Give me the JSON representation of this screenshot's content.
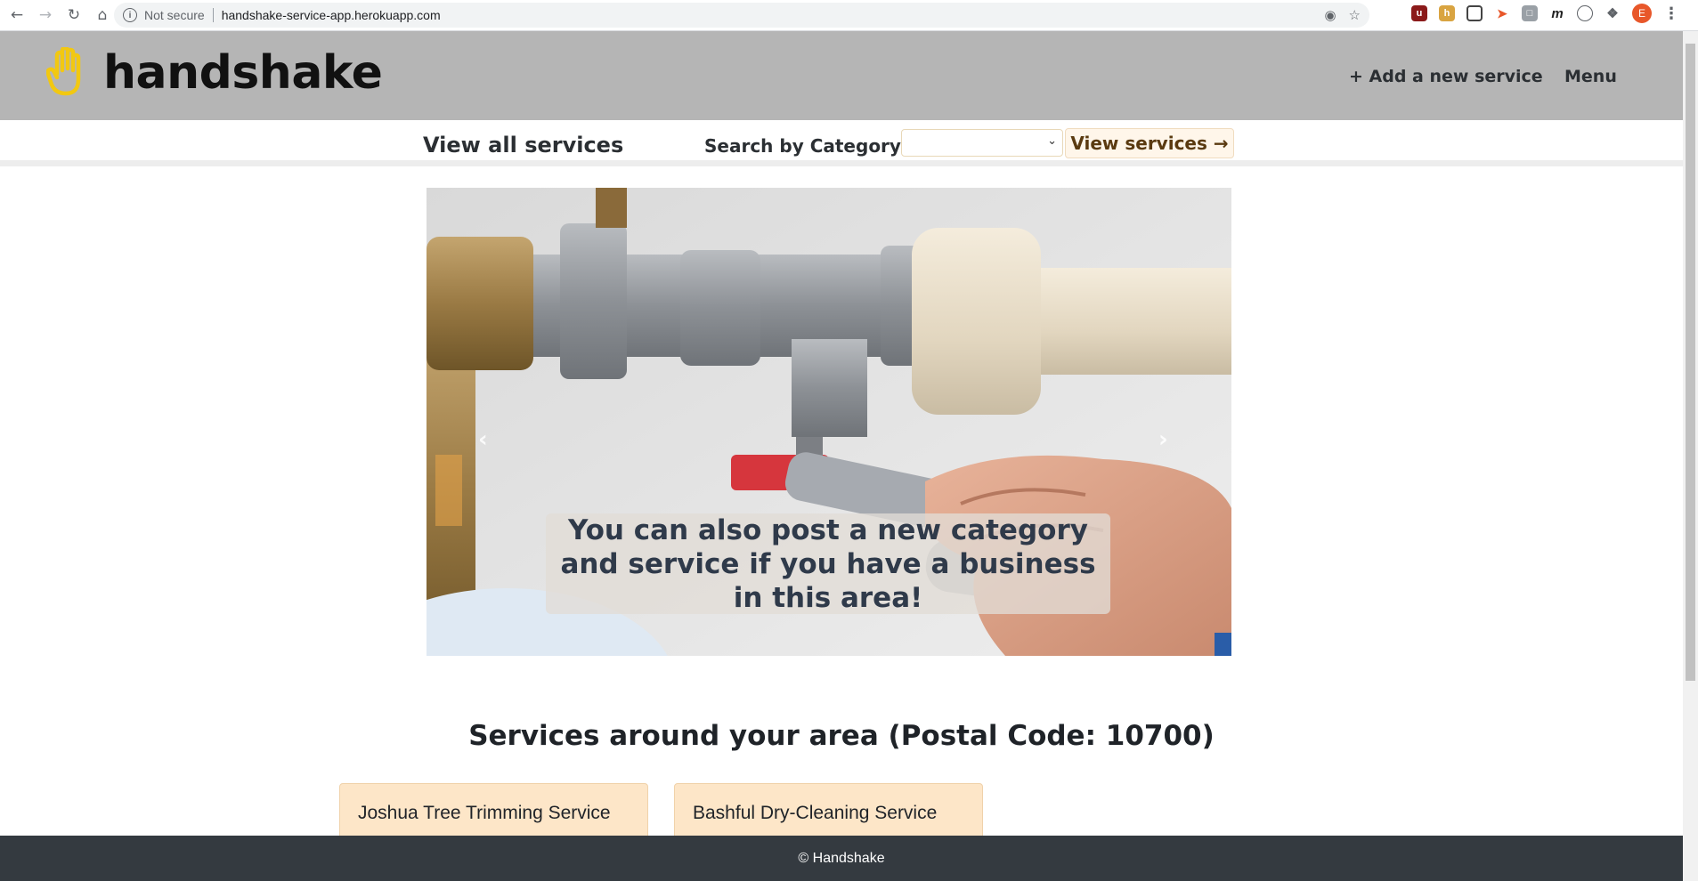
{
  "browser": {
    "security_label": "Not secure",
    "url": "handshake-service-app.herokuapp.com",
    "profile_initial": "E"
  },
  "header": {
    "logo_text": "handshake",
    "add_service_label": "+ Add a new service",
    "menu_label": "Menu",
    "logo_color": "#f2c811",
    "background": "#b5b5b5"
  },
  "subnav": {
    "view_all_label": "View all services",
    "search_label": "Search by Category:",
    "category_selected": "",
    "view_services_label": "View services →"
  },
  "carousel": {
    "caption": "You can also post a new category and service if you have a business in this area!",
    "prev_icon": "chevron-left-icon",
    "next_icon": "chevron-right-icon"
  },
  "services": {
    "title": "Services around your area (Postal Code: 10700)",
    "cards": [
      {
        "name": "Joshua Tree Trimming Service"
      },
      {
        "name": "Bashful Dry-Cleaning Service"
      }
    ]
  },
  "footer": {
    "text": "© Handshake"
  }
}
